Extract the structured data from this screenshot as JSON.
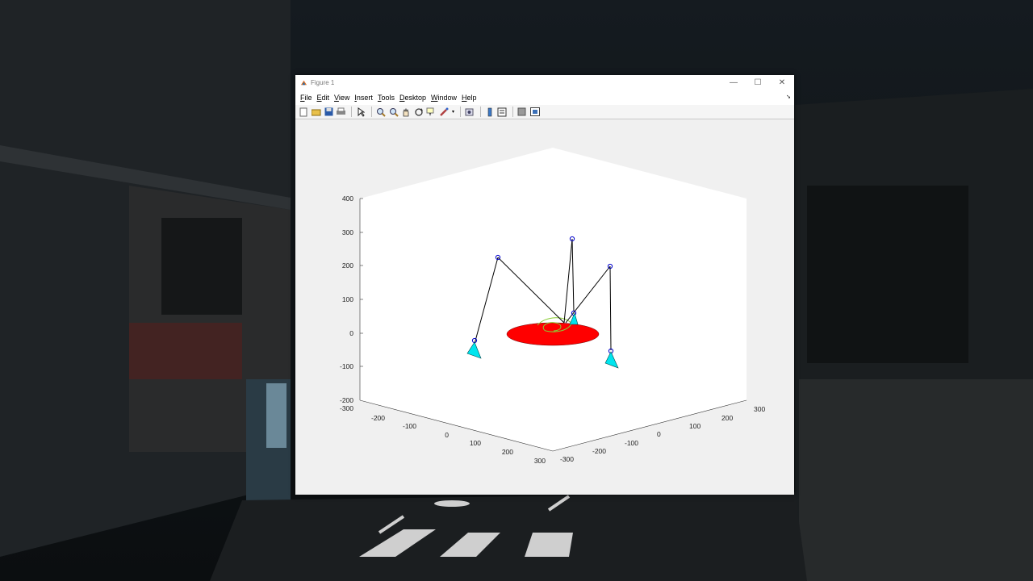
{
  "window": {
    "title": "Figure 1",
    "controls": [
      "—",
      "☐",
      "✕"
    ]
  },
  "menu": {
    "items": [
      "File",
      "Edit",
      "View",
      "Insert",
      "Tools",
      "Desktop",
      "Window",
      "Help"
    ]
  },
  "toolbar": {
    "icons": [
      "new-figure-icon",
      "open-file-icon",
      "save-icon",
      "print-icon",
      "edit-plot-icon",
      "zoom-in-icon",
      "zoom-out-icon",
      "pan-icon",
      "rotate-3d-icon",
      "data-cursor-icon",
      "brush-icon",
      "link-plot-icon",
      "colorbar-icon",
      "legend-icon",
      "hide-plot-tools-icon",
      "show-plot-tools-icon"
    ]
  },
  "axes": {
    "z_ticks": [
      "400",
      "300",
      "200",
      "100",
      "0",
      "-100",
      "-200"
    ],
    "x_ticks": [
      "-300",
      "-200",
      "-100",
      "0",
      "100",
      "200",
      "300"
    ],
    "y_ticks": [
      "-300",
      "-200",
      "-100",
      "0",
      "100",
      "200",
      "300"
    ]
  },
  "colors": {
    "platform": "#ff0000",
    "feet": "#00e5ee",
    "legs": "#000000",
    "joints": "#0000cc",
    "trace": "#88cc33"
  }
}
